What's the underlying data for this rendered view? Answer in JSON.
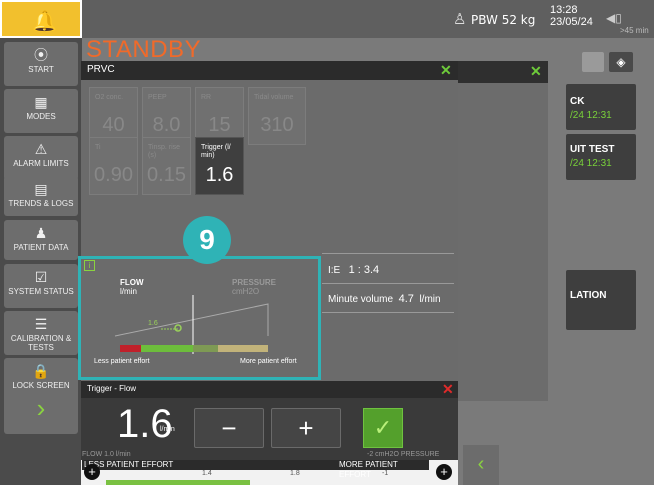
{
  "topbar": {
    "pbw": "PBW 52 kg",
    "time": "13:28",
    "date": "23/05/24",
    "battery_time": ">45 min"
  },
  "sidebar": {
    "items": [
      {
        "label": "START"
      },
      {
        "label": "MODES"
      },
      {
        "label": "ALARM LIMITS"
      },
      {
        "label": "TRENDS & LOGS"
      },
      {
        "label": "PATIENT DATA"
      },
      {
        "label": "SYSTEM STATUS"
      },
      {
        "label": "CALIBRATION & TESTS"
      },
      {
        "label": "LOCK SCREEN"
      }
    ]
  },
  "status": "STANDBY",
  "right_cards": [
    {
      "title": "CK",
      "time": "/24 12:31"
    },
    {
      "title": "UIT TEST",
      "time": "/24 12:31"
    },
    {
      "title": "LATION"
    }
  ],
  "dialog": {
    "title": "PRVC",
    "params": [
      {
        "label": "O2 conc.",
        "value": "40"
      },
      {
        "label": "PEEP",
        "value": "8.0"
      },
      {
        "label": "RR",
        "value": "15"
      },
      {
        "label": "Tidal volume",
        "value": "310"
      },
      {
        "label": "Ti",
        "value": "0.90"
      },
      {
        "label": "Tinsp. rise (s)",
        "value": "0.15"
      },
      {
        "label": "Trigger (l/ min)",
        "value": "1.6"
      }
    ],
    "ie_label": "I:E",
    "ie_value": "1 : 3.4",
    "mv_label": "Minute volume",
    "mv_value": "4.7",
    "mv_unit": "l/min"
  },
  "graph": {
    "info": "i",
    "flow_label": "FLOW",
    "flow_unit": "l/min",
    "pressure_label": "PRESSURE",
    "pressure_unit": "cmH2O",
    "marker_value": "1.6",
    "less_effort": "Less patient effort",
    "more_effort": "More patient effort",
    "badge": "9"
  },
  "trigger": {
    "title": "Trigger - Flow",
    "value": "1.6",
    "unit": "l/min",
    "minus": "−",
    "plus": "+",
    "confirm": "✓",
    "flow_current": "FLOW 1.0 l/min",
    "pressure_current": "-2 cmH2O PRESSURE",
    "less_effort": "LESS PATIENT EFFORT",
    "more_effort": "MORE PATIENT EFFORT",
    "ticks": [
      "1.4",
      "1.8",
      "-1"
    ]
  }
}
